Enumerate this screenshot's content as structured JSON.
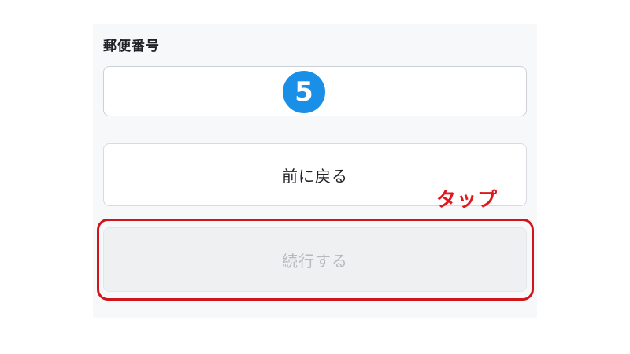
{
  "form": {
    "postal_label": "郵便番号",
    "postal_value": "",
    "postal_placeholder": ""
  },
  "step_badge": {
    "number": "5",
    "color": "#1a8fe8"
  },
  "buttons": {
    "back_label": "前に戻る",
    "continue_label": "続行する",
    "continue_state": "disabled"
  },
  "annotation": {
    "tap_label": "タップ",
    "color": "#e0171d"
  }
}
